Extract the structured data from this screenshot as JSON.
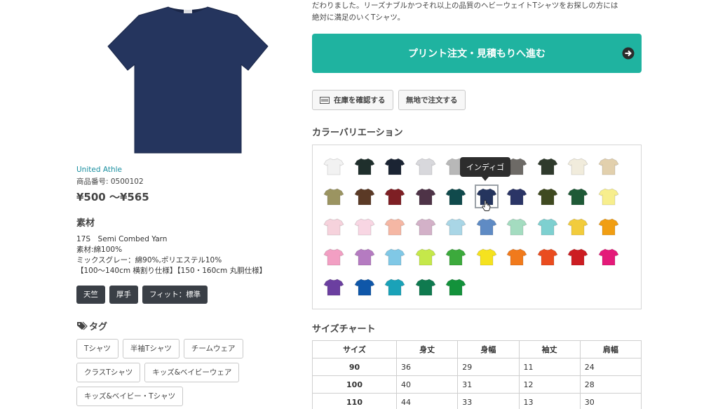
{
  "product": {
    "brand": "United Athle",
    "product_number": "商品番号: 0500102",
    "price": "¥500 〜¥565",
    "hero_color": "#25355e"
  },
  "material": {
    "heading": "素材",
    "lines": [
      "17S　Semi Combed Yarn",
      "素材:綿100%",
      "ミックスグレー：綿90%,ポリエステル10%",
      "【100〜140cm 横割り仕様】【150・160cm 丸胴仕様】"
    ],
    "badges": [
      "天竺",
      "厚手",
      "フィット：標準"
    ]
  },
  "tags": {
    "heading": "タグ",
    "items": [
      "Tシャツ",
      "半袖Tシャツ",
      "チームウェア",
      "クラスTシャツ",
      "キッズ&ベイビーウェア",
      "キッズ&ベイビー・Tシャツ"
    ]
  },
  "description": {
    "line1": "だわりました。リーズナブルかつそれ以上の品質のヘビーウェイトTシャツをお探しの方には",
    "line2": "絶対に満足のいくTシャツ。"
  },
  "cta": {
    "label": "プリント注文・見積もりへ進む",
    "color": "#1fb3a0"
  },
  "buttons": {
    "stock": "在庫を確認する",
    "plain_order": "無地で注文する"
  },
  "colors": {
    "heading": "カラーバリエーション",
    "tooltip": "インディゴ",
    "swatches": [
      "#f2f2f2",
      "#1f2f2c",
      "#1b2433",
      "#d8d8dc",
      "#b8b8b8",
      "#7a7a7a",
      "#6d6a66",
      "#2f3a2c",
      "#f1ecdc",
      "#e2d0ad",
      "#9b9461",
      "#5b3a26",
      "#7e1f24",
      "#4e3347",
      "#104a4c",
      "#25355e",
      "#2b3566",
      "#3f4a20",
      "#1f5a37",
      "#f7ee8d",
      "#f6d2dc",
      "#f8d6e3",
      "#f5b7a4",
      "#d3b1c8",
      "#a9d6e6",
      "#5f8bc4",
      "#a4dcc0",
      "#7ed0d0",
      "#f2cc3c",
      "#f19e12",
      "#f29fc3",
      "#b57bc1",
      "#80c8e6",
      "#c5e84a",
      "#3caa3c",
      "#f5e21f",
      "#f17a1c",
      "#ea4c1f",
      "#cc1d22",
      "#e41a79",
      "#6b3fa0",
      "#0f57a9",
      "#1aa2b8",
      "#0f7a4f",
      "#13923b"
    ],
    "selected_index": 15
  },
  "size_chart": {
    "heading": "サイズチャート",
    "headers": [
      "サイズ",
      "身丈",
      "身幅",
      "袖丈",
      "肩幅"
    ],
    "rows": [
      [
        "90",
        "36",
        "29",
        "11",
        "24"
      ],
      [
        "100",
        "40",
        "31",
        "12",
        "28"
      ],
      [
        "110",
        "44",
        "33",
        "13",
        "30"
      ]
    ]
  }
}
